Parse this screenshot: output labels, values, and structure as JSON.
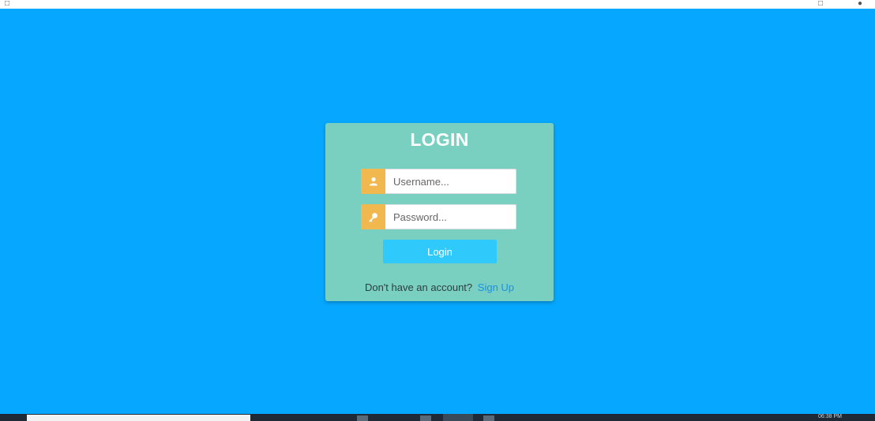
{
  "login_card": {
    "title": "LOGIN",
    "username": {
      "placeholder": "Username...",
      "icon": "user-icon"
    },
    "password": {
      "placeholder": "Password...",
      "icon": "key-icon"
    },
    "login_button_label": "Login",
    "signup_prompt": "Don't have an account?",
    "signup_link_label": "Sign Up"
  },
  "taskbar": {
    "clock": "06:38 PM"
  },
  "colors": {
    "background": "#06a7ff",
    "card": "#79cfc0",
    "icon_box": "#f1b84f",
    "button": "#2fc9fb",
    "link": "#1e8fe6"
  }
}
